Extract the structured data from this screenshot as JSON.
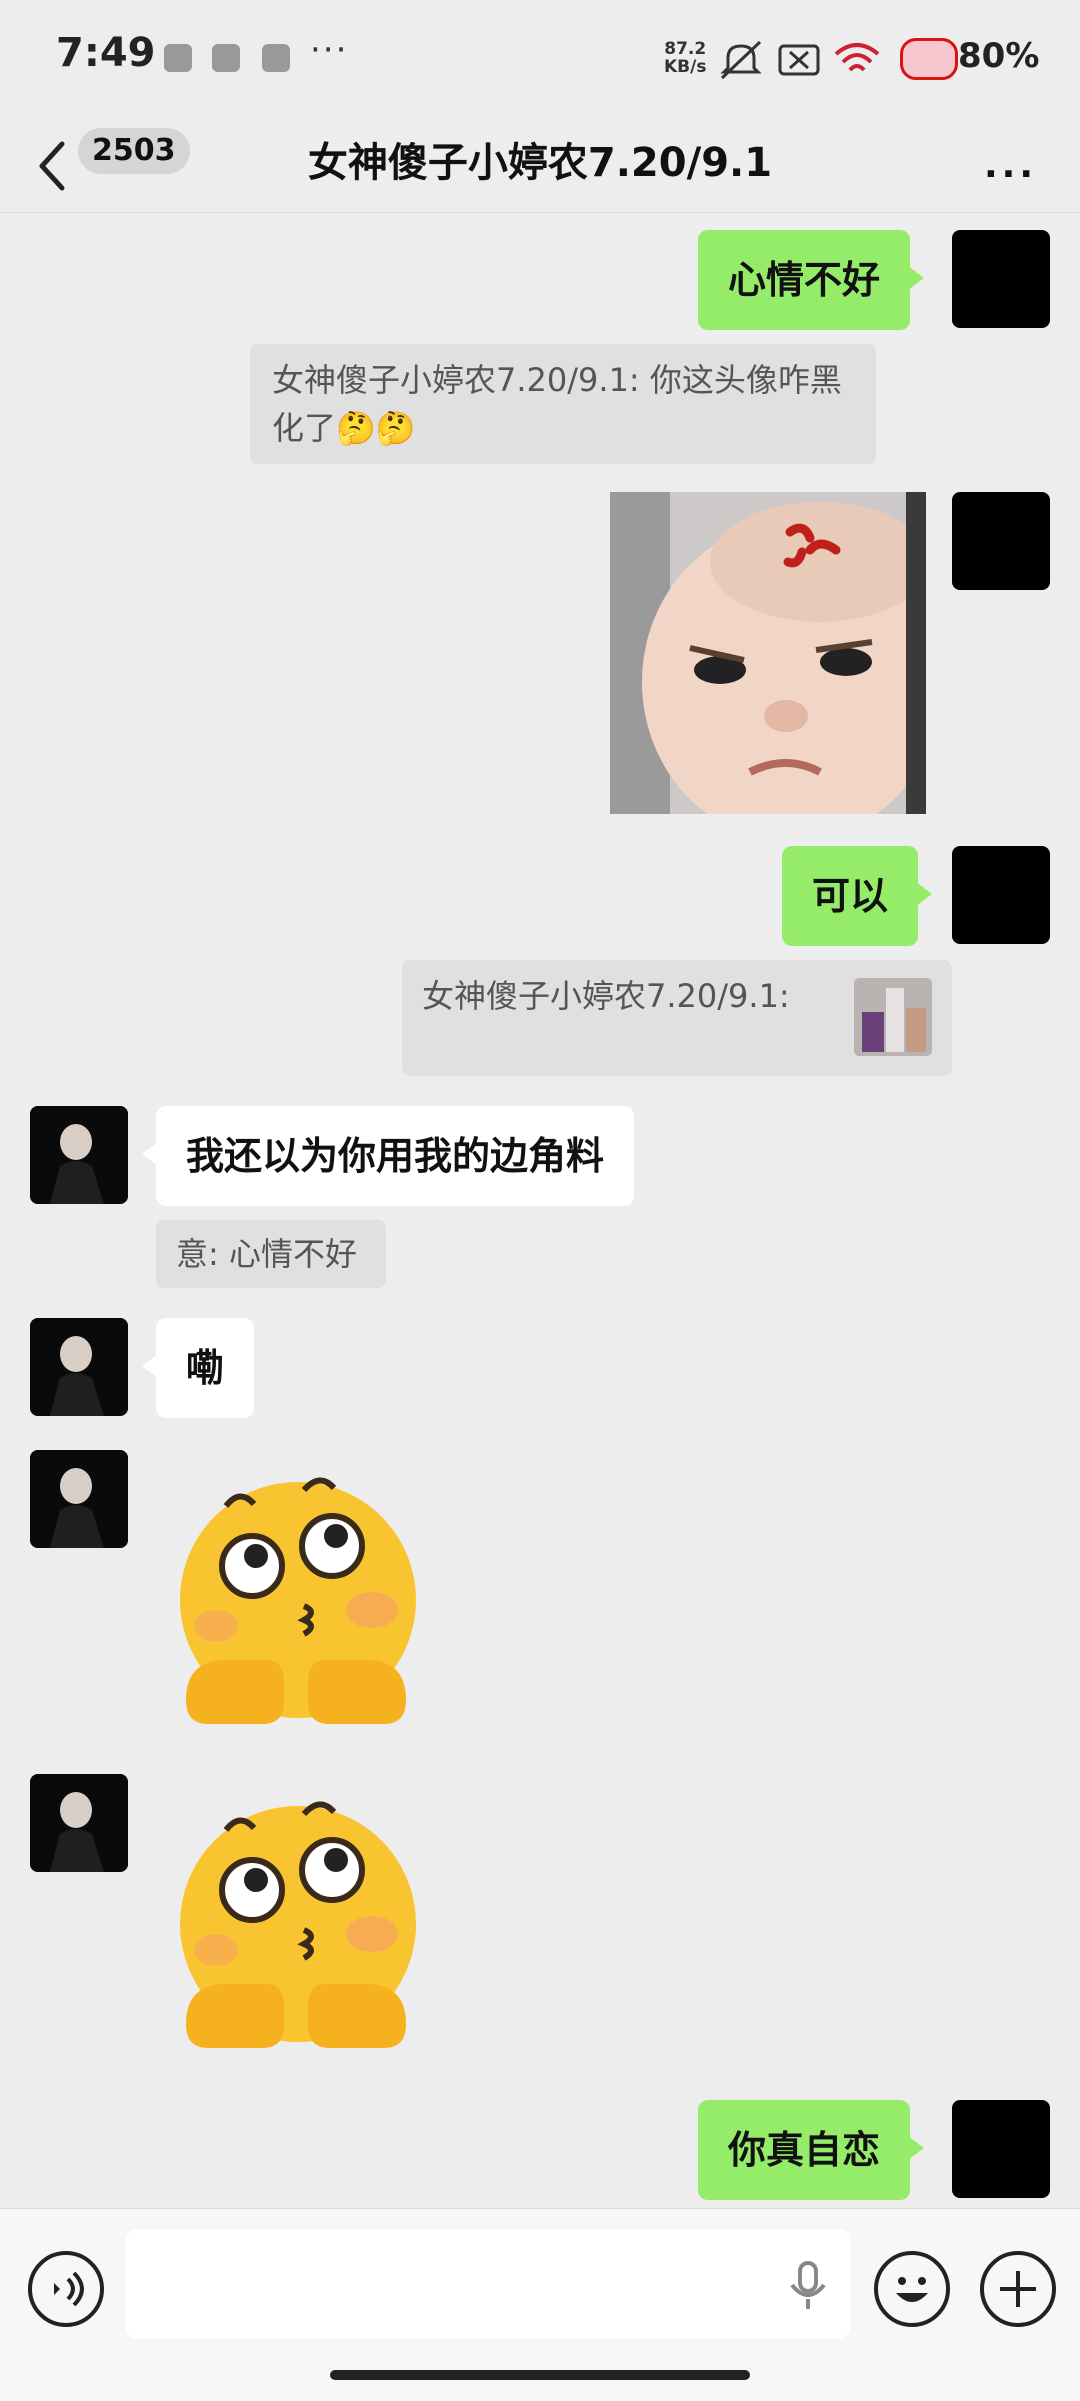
{
  "status_bar": {
    "time": "7:49",
    "net_speed_value": "87.2",
    "net_speed_unit": "KB/s",
    "battery": "80%",
    "more_icons": "···"
  },
  "header": {
    "unread_count": "2503",
    "title": "女神傻子小婷农7.20/9.1",
    "more": "···"
  },
  "messages": {
    "m1": {
      "text": "心情不好"
    },
    "q1": {
      "text": "女神傻子小婷农7.20/9.1: 你这头像咋黑化了🤔🤔"
    },
    "m3": {
      "text": "可以"
    },
    "q2": {
      "text": "女神傻子小婷农7.20/9.1:"
    },
    "o1": {
      "text": "我还以为你用我的边角料"
    },
    "q3": {
      "text": "意: 心情不好"
    },
    "o2": {
      "text": "嘞"
    },
    "m4": {
      "text": "你真自恋"
    }
  },
  "colors": {
    "background": "#ededed",
    "my_bubble": "#95ec69",
    "other_bubble": "#ffffff",
    "quote_bg": "#e0e0e0"
  }
}
